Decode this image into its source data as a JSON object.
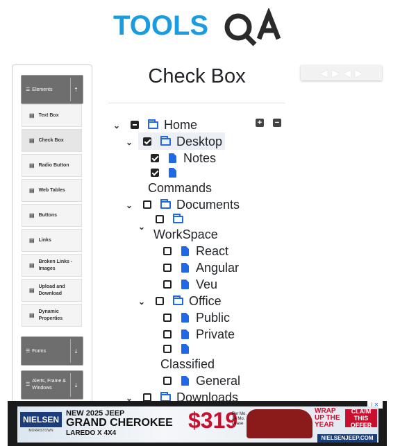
{
  "header": {
    "logo_text_1": "TOOLS",
    "logo_text_2": "QA"
  },
  "sidebar": {
    "groups": [
      {
        "label": "Elements",
        "toggle_icon": "arrow-up-icon"
      },
      {
        "label": "Forms",
        "toggle_icon": "arrow-down-icon"
      },
      {
        "label": "Alerts, Frame & Windows",
        "toggle_icon": "arrow-down-icon"
      }
    ],
    "items": [
      {
        "label": "Text Box"
      },
      {
        "label": "Check Box"
      },
      {
        "label": "Radio Button"
      },
      {
        "label": "Web Tables"
      },
      {
        "label": "Buttons"
      },
      {
        "label": "Links"
      },
      {
        "label": "Broken Links - Images"
      },
      {
        "label": "Upload and Download"
      },
      {
        "label": "Dynamic Properties"
      }
    ]
  },
  "main": {
    "title": "Check Box",
    "tree": {
      "home": "Home",
      "desktop": "Desktop",
      "notes": "Notes",
      "commands": "Commands",
      "documents": "Documents",
      "workspace": "WorkSpace",
      "react": "React",
      "angular": "Angular",
      "veu": "Veu",
      "office": "Office",
      "public": "Public",
      "private": "Private",
      "classified": "Classified",
      "general": "General",
      "downloads": "Downloads"
    },
    "expand_all": "+",
    "collapse_all": "−"
  },
  "ad": {
    "brand": "NIELSEN",
    "dealer": "MORRISTOWN",
    "line1": "NEW 2025 JEEP",
    "line2": "GRAND CHEROKEE",
    "line3": "LAREDO X 4X4",
    "price": "$319",
    "per": "Per Mo. 24 Mo. Lease",
    "wrap": "WRAP UP THE YEAR",
    "claim": "CLAIM THIS OFFER",
    "site": "NIELSENJEEP.COM",
    "info": "i ✕"
  }
}
